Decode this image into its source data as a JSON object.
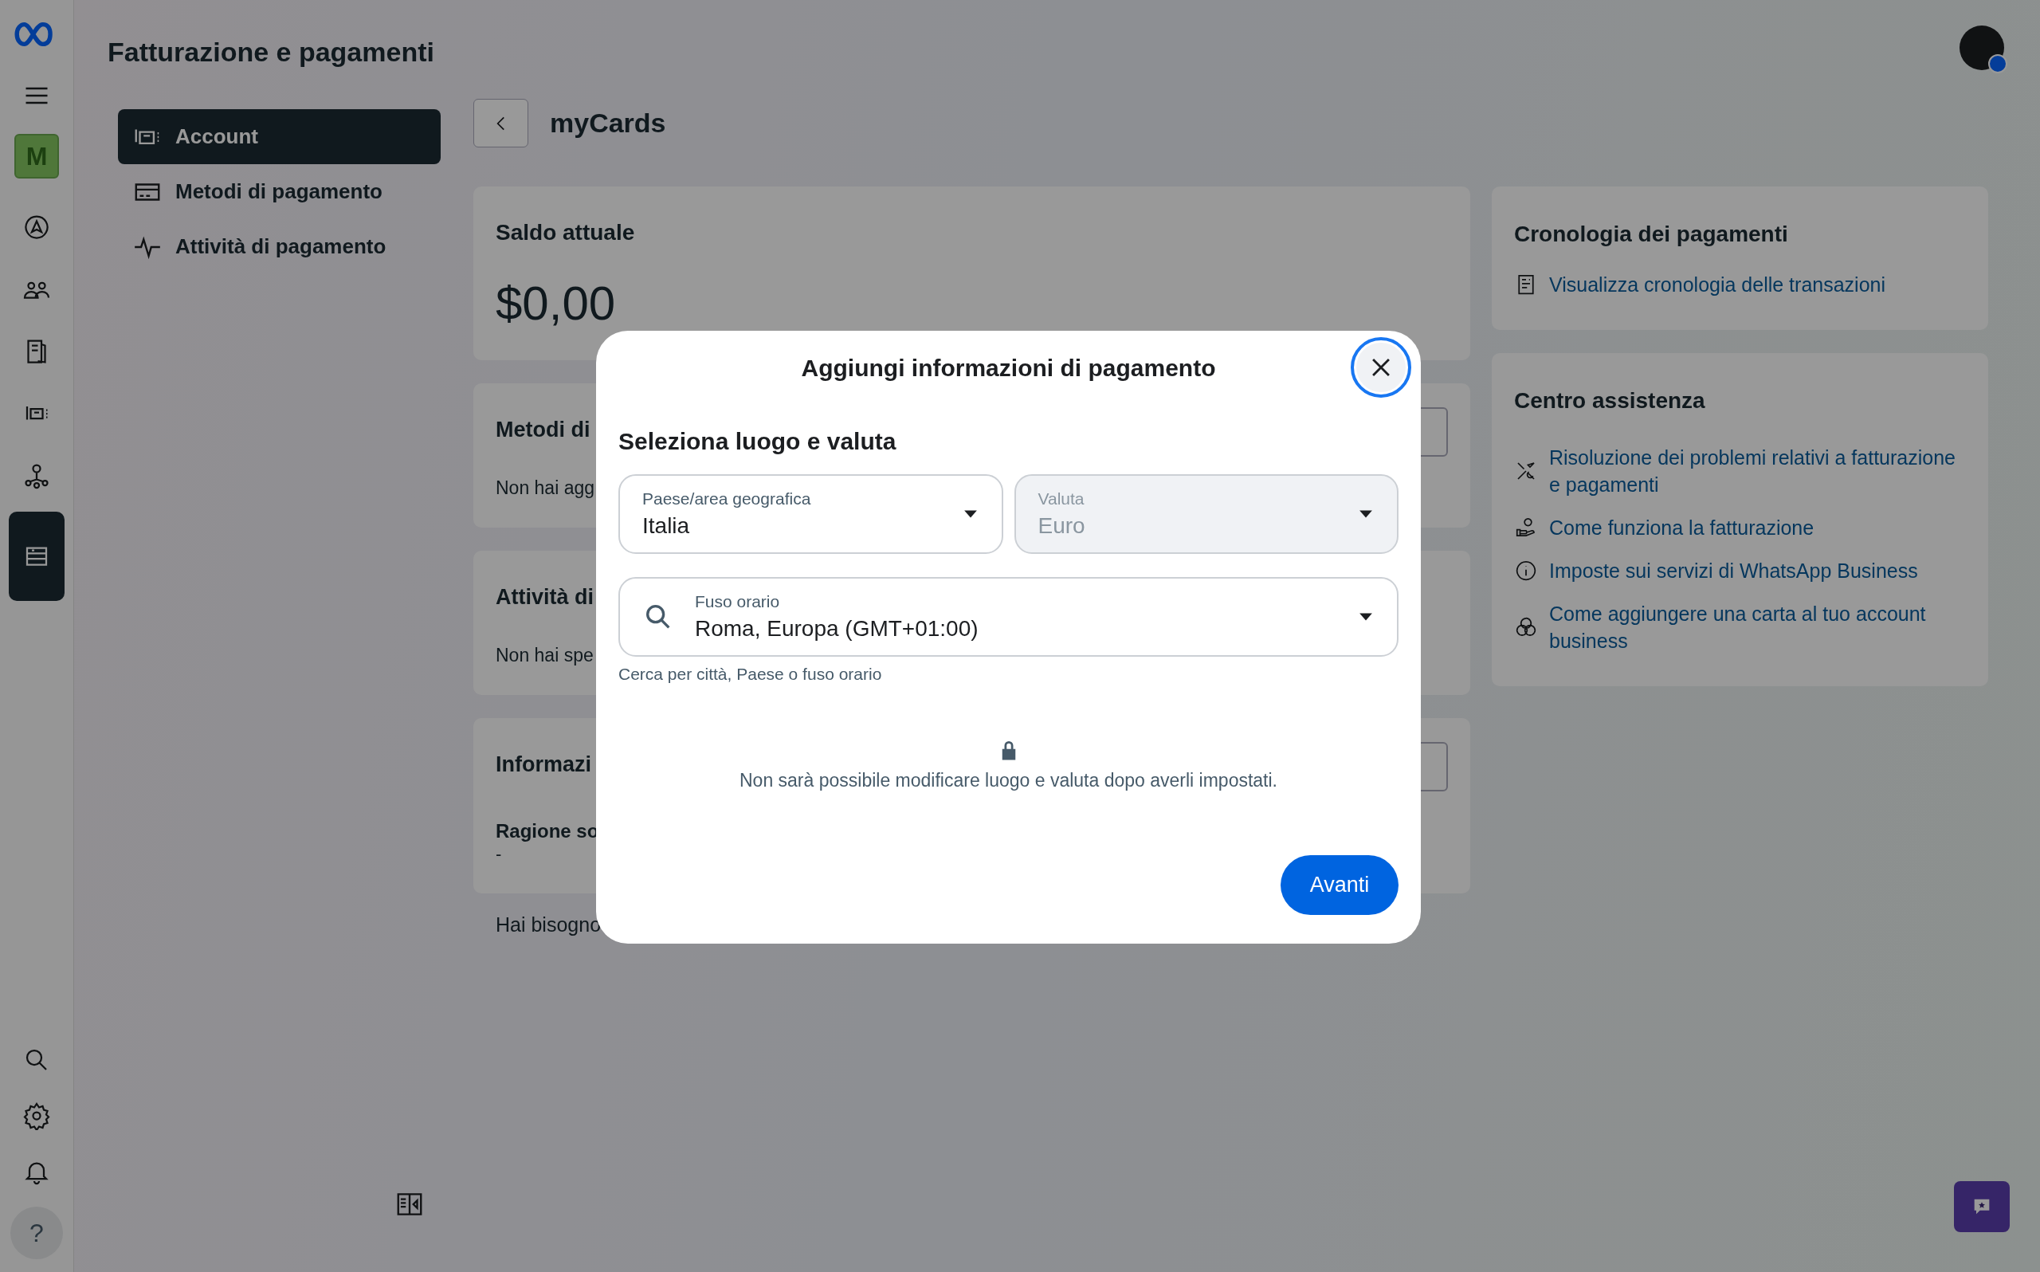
{
  "app": {
    "title": "Fatturazione e pagamenti"
  },
  "rail": {
    "account_initial": "M",
    "items": [
      {
        "kind": "compass",
        "selected": false
      },
      {
        "kind": "people",
        "selected": false
      },
      {
        "kind": "book",
        "selected": false
      },
      {
        "kind": "ads",
        "selected": false
      },
      {
        "kind": "network",
        "selected": false
      },
      {
        "kind": "billing",
        "selected": true
      }
    ],
    "bottom": [
      {
        "kind": "search"
      },
      {
        "kind": "settings"
      },
      {
        "kind": "bell"
      }
    ],
    "help": "?"
  },
  "nav": [
    {
      "kind": "account",
      "label": "Account",
      "selected": true
    },
    {
      "kind": "card",
      "label": "Metodi di pagamento",
      "selected": false
    },
    {
      "kind": "pulse",
      "label": "Attività di pagamento",
      "selected": false
    }
  ],
  "page": {
    "title": "myCards",
    "balance": {
      "title": "Saldo attuale",
      "amount": "$0,00"
    },
    "cards": [
      {
        "title": "Metodi di",
        "text": "Non hai agg",
        "has_button": true
      },
      {
        "title": "Attività di",
        "text": "Non hai spe",
        "has_button": false
      },
      {
        "title": "Informazi",
        "rows": [
          {
            "label": "Ragione so",
            "value": "-"
          }
        ],
        "has_button": true
      }
    ],
    "footer": "Hai bisogno"
  },
  "history": {
    "title": "Cronologia dei pagamenti",
    "link": "Visualizza cronologia delle transazioni"
  },
  "help_center": {
    "title": "Centro assistenza",
    "links": [
      {
        "kind": "tools",
        "text": "Risoluzione dei problemi relativi a fatturazione e pagamenti"
      },
      {
        "kind": "hand",
        "text": "Come funziona la fatturazione"
      },
      {
        "kind": "info",
        "text": "Imposte sui servizi di WhatsApp Business"
      },
      {
        "kind": "circles",
        "text": "Come aggiungere una carta al tuo account business"
      }
    ]
  },
  "modal": {
    "title": "Aggiungi informazioni di pagamento",
    "section": "Seleziona luogo e valuta",
    "fields": [
      {
        "label": "Paese/area geografica",
        "value": "Italia",
        "disabled": false
      },
      {
        "label": "Valuta",
        "value": "Euro",
        "disabled": true
      }
    ],
    "timezone": {
      "label": "Fuso orario",
      "value": "Roma, Europa (GMT+01:00)",
      "hint": "Cerca per città, Paese o fuso orario"
    },
    "notice": "Non sarà possibile modificare luogo e valuta dopo averli impostati.",
    "button": "Avanti"
  }
}
